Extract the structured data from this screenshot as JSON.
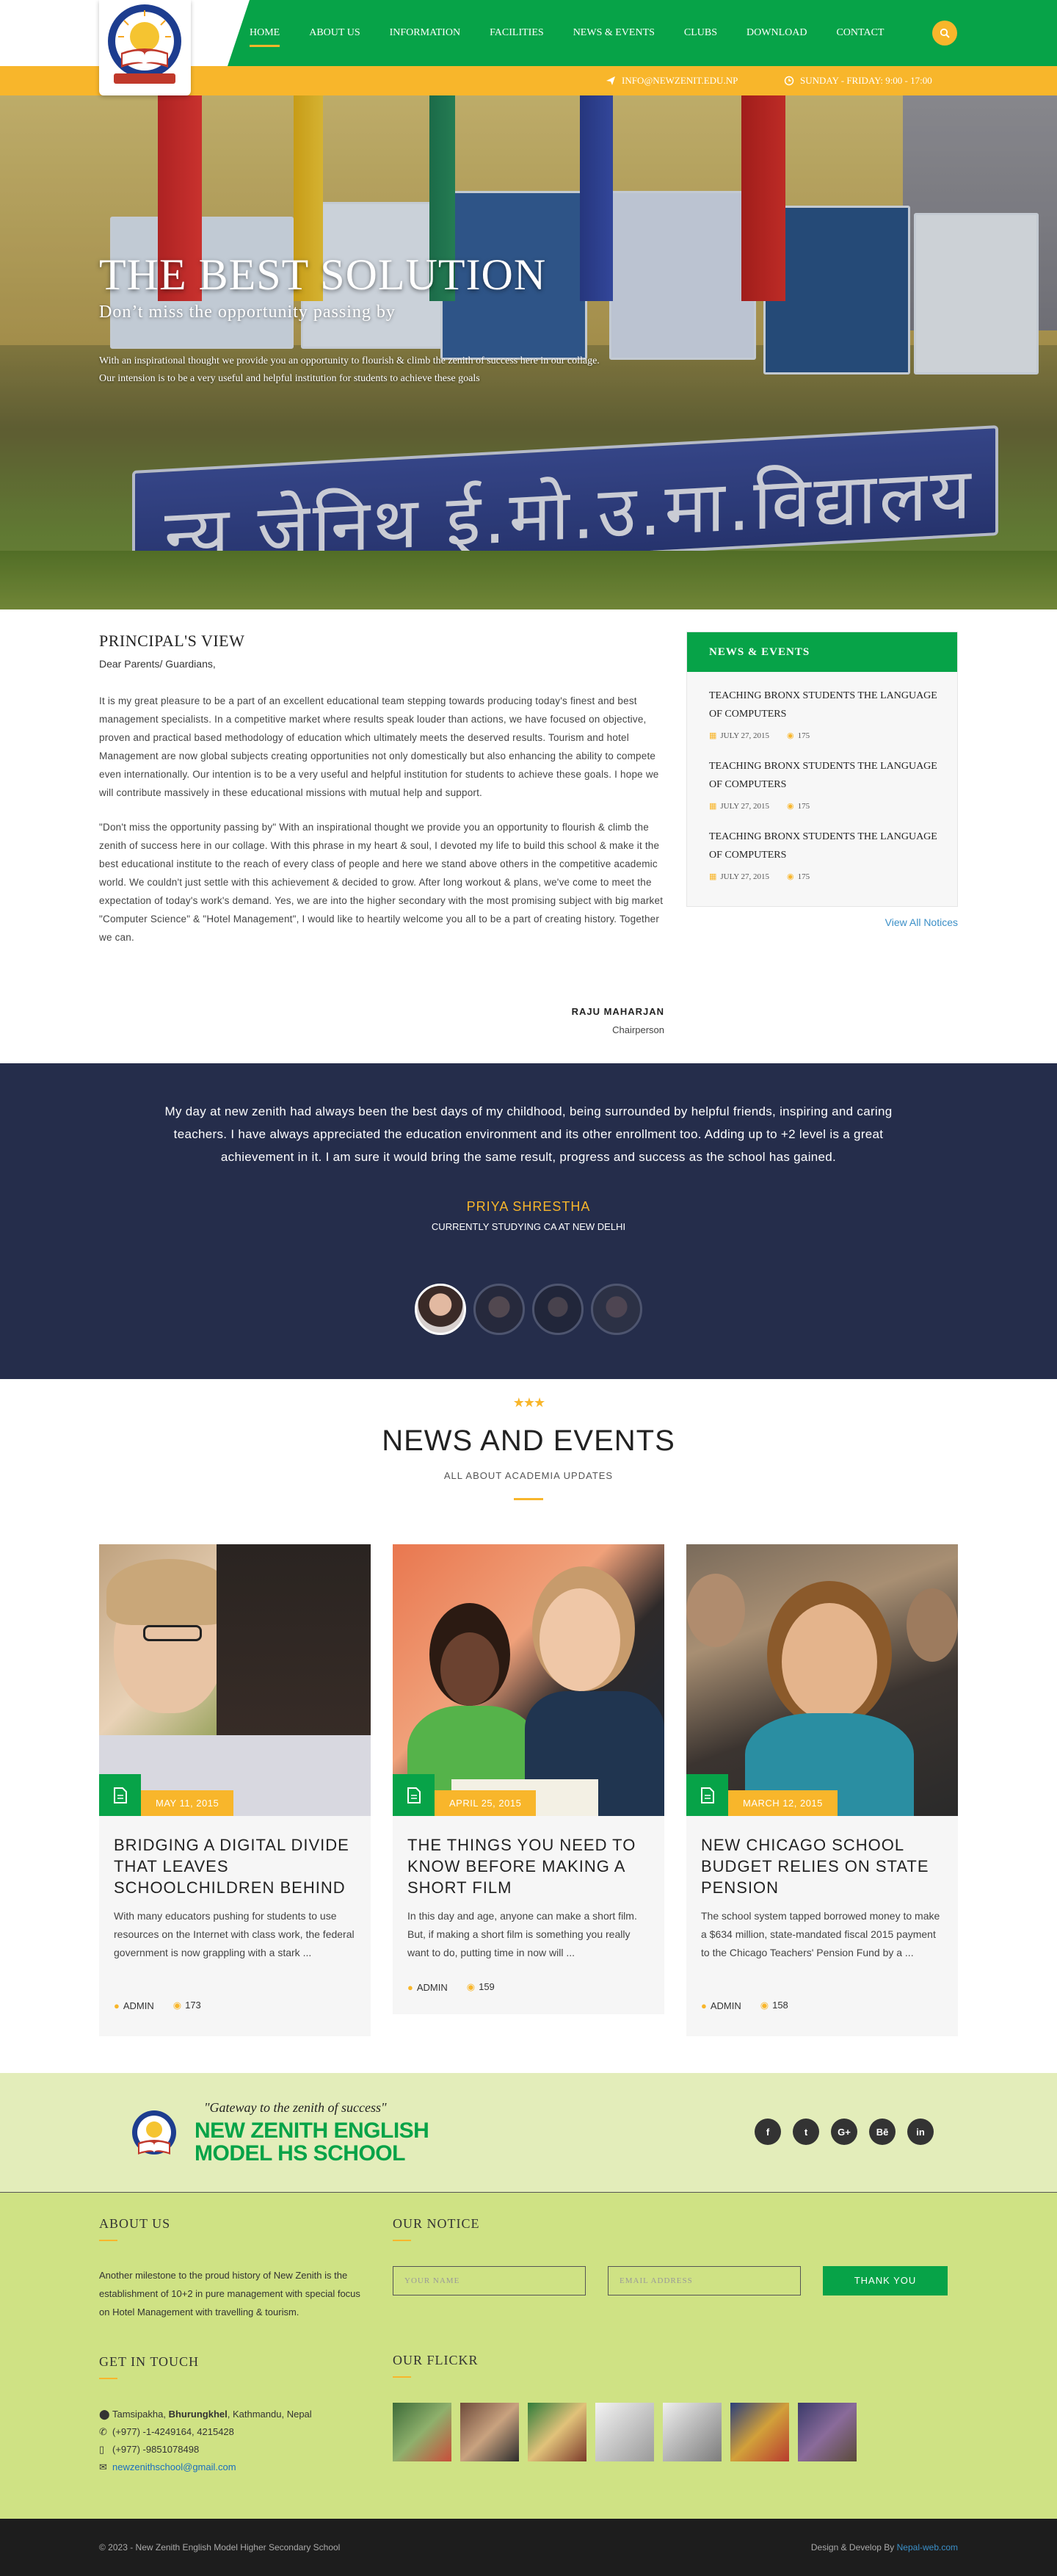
{
  "nav": {
    "items": [
      "HOME",
      "ABOUT US",
      "INFORMATION",
      "FACILITIES",
      "NEWS & EVENTS",
      "CLUBS",
      "DOWNLOAD",
      "CONTACT"
    ],
    "active": "HOME"
  },
  "topbar": {
    "email": "INFO@NEWZENIT.EDU.NP",
    "hours": "SUNDAY - FRIDAY: 9:00 - 17:00"
  },
  "hero": {
    "title": "THE BEST SOLUTION",
    "subtitle": "Don’t miss the opportunity passing by",
    "text": "With an inspirational thought we provide you an opportunity to flourish & climb the zenith of success here in our collage. Our intension is to be a very useful and helpful institution for students to achieve these goals",
    "sign_text": "न्यू जेनिथ ई.मो.उ.मा.विद्यालय"
  },
  "principal": {
    "heading": "PRINCIPAL'S VIEW",
    "greeting": "Dear Parents/ Guardians,",
    "para1": "It is my great pleasure to be a part of an excellent educational team stepping towards producing today's finest and best management specialists. In a competitive market where results speak louder than actions, we have focused on objective, proven and practical based methodology of education which ultimately meets the deserved results. Tourism and hotel Management are now global subjects creating opportunities not only domestically but also enhancing the ability to compete even internationally. Our intention is to be a very useful and helpful institution for students to achieve these goals. I hope we will contribute massively in these educational missions with mutual help and support.",
    "para2": "\"Don't miss the opportunity passing by\" With an inspirational thought we provide you an opportunity to flourish & climb the zenith of success here in our collage. With this phrase in my heart & soul, I devoted my life to build this school & make it the best educational institute to the reach of every class of people and here we stand above others in the competitive academic world. We couldn't just settle with this achievement & decided to grow. After long workout & plans, we've come to meet the expectation of today's work's demand. Yes, we are into the higher secondary with the most promising subject with big market \"Computer Science\" & \"Hotel Management\", I would like to heartily welcome you all to be a part of creating history. Together we can.",
    "name": "RAJU MAHARJAN",
    "role": "Chairperson"
  },
  "news_sidebar": {
    "heading": "NEWS & EVENTS",
    "items": [
      {
        "title": "TEACHING BRONX STUDENTS THE LANGUAGE OF COMPUTERS",
        "date": "JULY 27, 2015",
        "views": "175"
      },
      {
        "title": "TEACHING BRONX STUDENTS THE LANGUAGE OF COMPUTERS",
        "date": "JULY 27, 2015",
        "views": "175"
      },
      {
        "title": "TEACHING BRONX STUDENTS THE LANGUAGE OF COMPUTERS",
        "date": "JULY 27, 2015",
        "views": "175"
      }
    ],
    "view_all": "View All Notices"
  },
  "testimonial": {
    "quote": "My day at new zenith had always been the best days of my childhood, being surrounded by helpful friends, inspiring and caring teachers. I have always appreciated the education environment and its other enrollment too. Adding up to +2 level is a great achievement in it. I am sure it would bring the same result, progress and success as the school has gained.",
    "name": "PRIYA SHRESTHA",
    "role": "CURRENTLY STUDYING CA AT NEW DELHI"
  },
  "news_events": {
    "stars": "★★★",
    "title": "NEWS AND EVENTS",
    "subtitle": "ALL ABOUT ACADEMIA UPDATES",
    "cards": [
      {
        "date": "MAY 11, 2015",
        "title": "BRIDGING A DIGITAL DIVIDE THAT LEAVES SCHOOLCHILDREN BEHIND",
        "desc": "With many educators pushing for students to use resources on the Internet with class work, the federal government is now grappling with a stark ...",
        "author": "ADMIN",
        "views": "173"
      },
      {
        "date": "APRIL 25, 2015",
        "title": "THE THINGS YOU NEED TO KNOW BEFORE MAKING A SHORT FILM",
        "desc": "In this day and age, anyone can make a short film. But, if making a short film is something you really want to do, putting time in now will ...",
        "author": "ADMIN",
        "views": "159"
      },
      {
        "date": "MARCH 12, 2015",
        "title": "NEW CHICAGO SCHOOL BUDGET RELIES ON STATE PENSION",
        "desc": "The school system tapped borrowed money to make a $634 million, state-mandated fiscal 2015 payment to the Chicago Teachers' Pension Fund by a ...",
        "author": "ADMIN",
        "views": "158"
      }
    ]
  },
  "footer": {
    "tagline": "\"Gateway to the zenith of success\"",
    "school_line1": "NEW ZENITH ENGLISH",
    "school_line2": "MODEL HS SCHOOL",
    "social": [
      "f",
      "t",
      "G+",
      "Bē",
      "in"
    ],
    "about_heading": "ABOUT US",
    "about_text": "Another milestone to the proud history of New Zenith is the establishment of 10+2 in pure management with special focus on Hotel Management with travelling & tourism.",
    "notice_heading": "OUR NOTICE",
    "name_placeholder": "YOUR NAME",
    "email_placeholder": "EMAIL ADDRESS",
    "submit": "THANK YOU",
    "touch_heading": "GET IN TOUCH",
    "address_pre": "Tamsipakha, ",
    "address_bold": "Bhurungkhel",
    "address_post": ", Kathmandu, Nepal",
    "phone1": "(+977) -1-4249164, 4215428",
    "phone2": "(+977) -9851078498",
    "email": "newzenithschool@gmail.com",
    "flickr_heading": "OUR FLICKR",
    "copyright": "© 2023 - New Zenith English Model Higher Secondary School",
    "credit_pre": "Design & Develop By ",
    "credit_link": "Nepal-web.com"
  },
  "colors": {
    "green": "#07a348",
    "yellow": "#f8b62b",
    "navy": "#252d4b",
    "footer_green": "#cfe284"
  }
}
